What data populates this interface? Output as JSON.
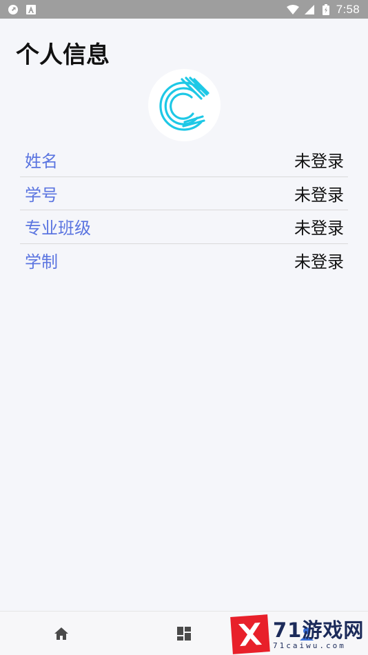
{
  "status_bar": {
    "time": "7:58",
    "icons": [
      "sync-icon",
      "a-badge-icon",
      "wifi-icon",
      "signal-icon",
      "battery-icon"
    ]
  },
  "page": {
    "title": "个人信息"
  },
  "profile": {
    "fields": [
      {
        "label": "姓名",
        "value": "未登录"
      },
      {
        "label": "学号",
        "value": "未登录"
      },
      {
        "label": "专业班级",
        "value": "未登录"
      },
      {
        "label": "学制",
        "value": "未登录"
      }
    ]
  },
  "bottom_nav": {
    "items": [
      {
        "icon": "home-icon"
      },
      {
        "icon": "dashboard-icon"
      },
      {
        "icon": "profile-icon"
      }
    ]
  },
  "watermark": {
    "brand": "71游戏网",
    "domain": "71caiwu.com"
  },
  "colors": {
    "label": "#5a74e0",
    "value": "#111111",
    "background": "#f5f6fa",
    "status_bar": "#9e9e9e",
    "logo_cyan": "#1ec8e6"
  }
}
